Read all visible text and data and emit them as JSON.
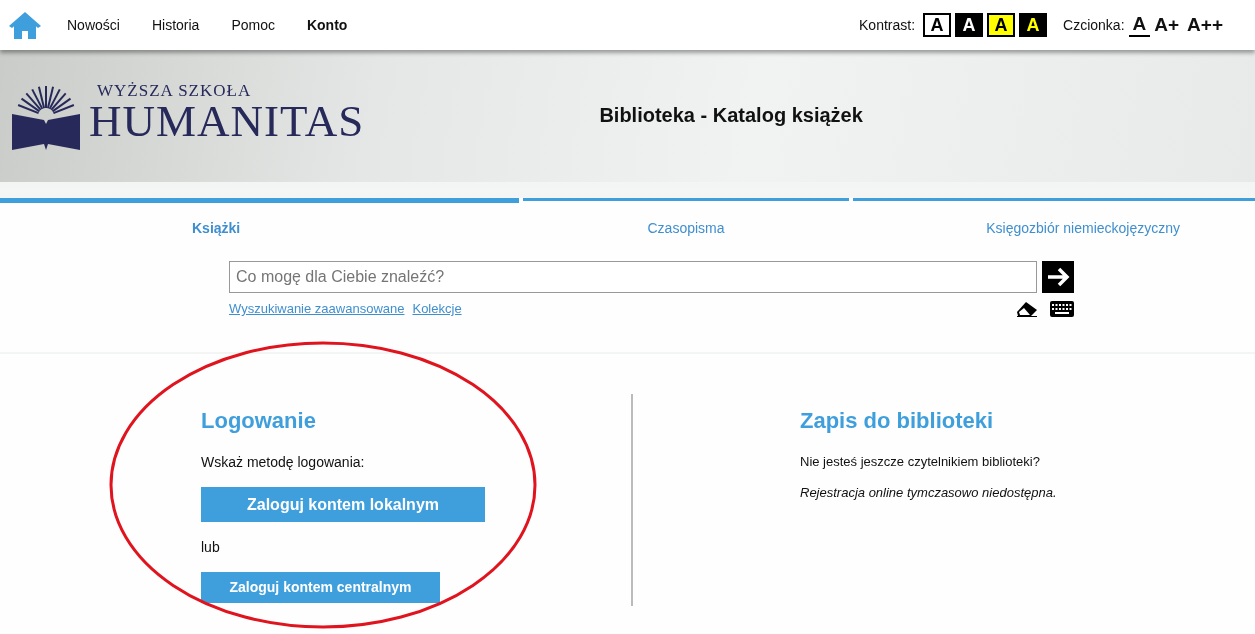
{
  "top_nav": {
    "items": [
      {
        "label": "Nowości",
        "selected": false
      },
      {
        "label": "Historia",
        "selected": false
      },
      {
        "label": "Pomoc",
        "selected": false
      },
      {
        "label": "Konto",
        "selected": true
      }
    ],
    "contrast": {
      "label": "Kontrast:",
      "options": [
        {
          "label": "A",
          "kind": "white"
        },
        {
          "label": "A",
          "kind": "black"
        },
        {
          "label": "A",
          "kind": "yellow"
        },
        {
          "label": "A",
          "kind": "black-yellow"
        }
      ]
    },
    "font_size": {
      "label": "Czcionka:",
      "options": [
        {
          "label": "A",
          "selected": true
        },
        {
          "label": "A+",
          "selected": false
        },
        {
          "label": "A++",
          "selected": false
        }
      ]
    }
  },
  "banner": {
    "logo_line_1": "WYŻSZA SZKOŁA",
    "logo_line_2": "HUMANITAS",
    "title": "Biblioteka - Katalog książek"
  },
  "tabs": [
    {
      "label": "Książki",
      "selected": true
    },
    {
      "label": "Czasopisma",
      "selected": false
    },
    {
      "label": "Księgozbiór niemieckojęzyczny",
      "selected": false
    }
  ],
  "search": {
    "placeholder": "Co mogę dla Ciebie znaleźć?",
    "links": [
      "Wyszukiwanie zaawansowane",
      "Kolekcje"
    ]
  },
  "login": {
    "title": "Logowanie",
    "prompt": "Wskaż metodę logowania:",
    "buttons": [
      {
        "label": "Zaloguj kontem lokalnym",
        "kind": "large"
      },
      {
        "label": "lub",
        "kind": "separator"
      },
      {
        "label": "Zaloguj kontem centralnym",
        "kind": "small"
      }
    ]
  },
  "register": {
    "title": "Zapis do biblioteki",
    "question": "Nie jesteś jeszcze czytelnikiem biblioteki?",
    "note": "Rejestracja online tymczasowo niedostępna."
  },
  "annotation": {
    "kind": "ellipse",
    "color": "#e0141e"
  }
}
